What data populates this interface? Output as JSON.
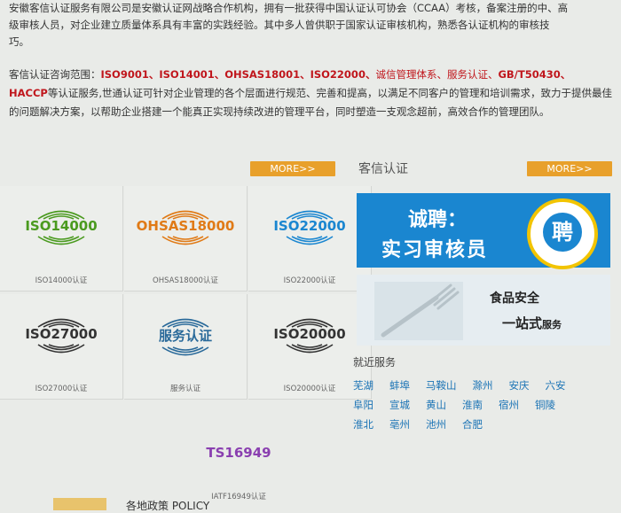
{
  "intro": {
    "line1": "安徽客信认证服务有限公司是安徽认证网战略合作机构，拥有一批获得中国认证认可协会（CCAA）考核，备案注册的中、高",
    "line2": "级审核人员，对企业建立质量体系具有丰富的实践经验。其中多人曾供职于国家认证审核机构，熟悉各认证机构的审核技",
    "line3": "巧。"
  },
  "scope": {
    "label": "客信认证咨询范围：",
    "items": [
      "ISO9001、",
      "ISO14001、",
      "OHSAS18001、",
      "ISO22000、",
      "诚信管理体系、",
      "服务认证、",
      "GB/T50430、"
    ],
    "item_haccp": "HACCP",
    "rest": "等认证服务,世通认证可针对企业管理的各个层面进行规范、完善和提高，以满足不同客户的管理和培训需求，致力于提供最佳的问题解决方案，以帮助企业搭建一个能真正实现持续改进的管理平台，同时塑造一支观念超前，高效合作的管理团队。"
  },
  "more_label": "MORE>>",
  "section_title": "客信认证",
  "cert_grid": [
    {
      "code": "ISO14000",
      "caption": "ISO14000认证",
      "color": "#4a9a1f"
    },
    {
      "code": "OHSAS18000",
      "caption": "OHSAS18000认证",
      "color": "#e07a16"
    },
    {
      "code": "ISO22000",
      "caption": "ISO22000认证",
      "color": "#1a86d0"
    },
    {
      "code": "ISO27000",
      "caption": "ISO27000认证",
      "color": "#333333"
    },
    {
      "code": "服务认证",
      "caption": "服务认证",
      "color": "#2a6a9a"
    },
    {
      "code": "ISO20000",
      "caption": "ISO20000认证",
      "color": "#333333"
    },
    {
      "code": "TS16949",
      "caption": "IATF16949认证",
      "color": "#8a3fb0"
    }
  ],
  "banner_recruit": {
    "line1": "诚聘：",
    "line2": "实习审核员",
    "char": "聘"
  },
  "banner_food": {
    "line1": "食品安全",
    "line2": "一站式",
    "line2_small": "服务"
  },
  "nearby": {
    "title": "就近服务",
    "cities": [
      "芜湖",
      "蚌埠",
      "马鞍山",
      "滁州",
      "安庆",
      "六安",
      "阜阳",
      "宣城",
      "黄山",
      "淮南",
      "宿州",
      "铜陵",
      "淮北",
      "亳州",
      "池州",
      "合肥"
    ]
  },
  "footer": {
    "label": "各地政策 POLICY"
  }
}
